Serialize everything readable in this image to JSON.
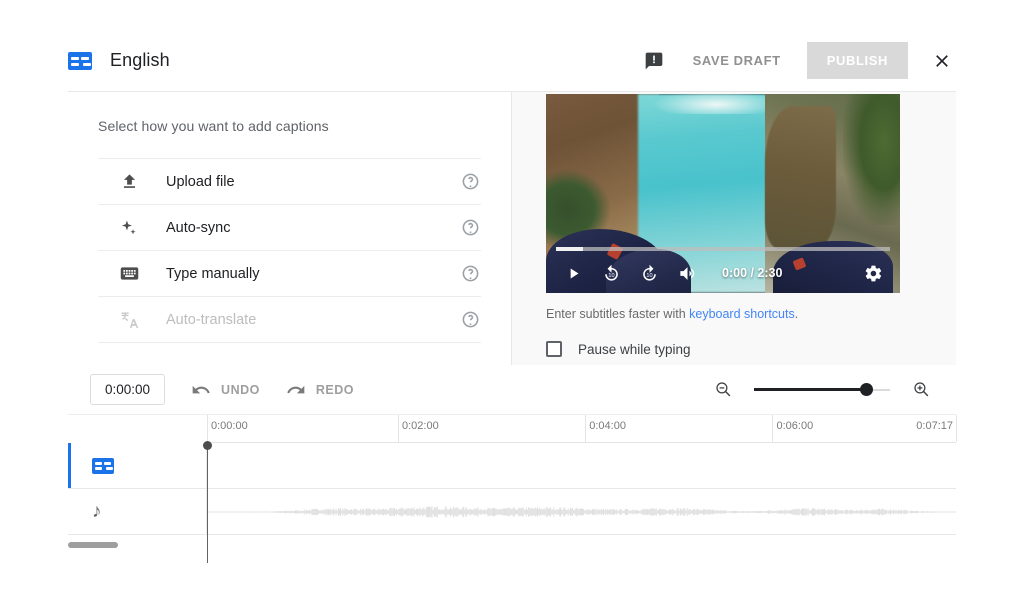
{
  "header": {
    "language_title": "English",
    "lang_icon": "subtitles-icon",
    "feedback_icon": "feedback-icon",
    "save_draft_label": "SAVE DRAFT",
    "publish_label": "PUBLISH",
    "close_icon": "close-icon"
  },
  "left_pane": {
    "heading": "Select how you want to add captions",
    "options": [
      {
        "icon": "upload-icon",
        "label": "Upload file",
        "help_icon": "help-icon",
        "disabled": false
      },
      {
        "icon": "sparkle-icon",
        "label": "Auto-sync",
        "help_icon": "help-icon",
        "disabled": false
      },
      {
        "icon": "keyboard-icon",
        "label": "Type manually",
        "help_icon": "help-icon",
        "disabled": false
      },
      {
        "icon": "translate-icon",
        "label": "Auto-translate",
        "help_icon": "help-icon",
        "disabled": true
      }
    ]
  },
  "video": {
    "play_icon": "play-icon",
    "replay_icon": "replay-10-icon",
    "forward_icon": "forward-10-icon",
    "volume_icon": "volume-icon",
    "settings_icon": "gear-icon",
    "current_time": "0:00",
    "duration": "2:30",
    "time_display": "0:00 / 2:30",
    "progress_percent": 8
  },
  "right_pane": {
    "shortcuts_prefix": "Enter subtitles faster with ",
    "shortcuts_link": "keyboard shortcuts",
    "shortcuts_suffix": ".",
    "pause_label": "Pause while typing",
    "pause_checked": false
  },
  "toolbar": {
    "timecode": "0:00:00",
    "undo_label": "UNDO",
    "undo_icon": "undo-icon",
    "redo_label": "REDO",
    "redo_icon": "redo-icon",
    "zoom_out_icon": "zoom-out-icon",
    "zoom_in_icon": "zoom-in-icon",
    "zoom_value": 82
  },
  "timeline": {
    "ticks": [
      {
        "label": "0:00:00",
        "pos_percent": 0
      },
      {
        "label": "0:02:00",
        "pos_percent": 25.5
      },
      {
        "label": "0:04:00",
        "pos_percent": 50.5
      },
      {
        "label": "0:06:00",
        "pos_percent": 75.5
      },
      {
        "label": "0:07:17",
        "pos_percent": 100
      }
    ],
    "tracks": [
      {
        "type": "captions",
        "icon": "cc-track-icon",
        "selected": true
      },
      {
        "type": "audio",
        "icon": "music-note-icon",
        "selected": false
      }
    ],
    "playhead_time": "0:00:00",
    "scroll_position": 0
  },
  "colors": {
    "brand_blue": "#1a73e8",
    "link_blue": "#4285f4",
    "disabled_gray": "#d9d9d9",
    "text_primary": "#202124",
    "text_secondary": "#5f6368"
  }
}
